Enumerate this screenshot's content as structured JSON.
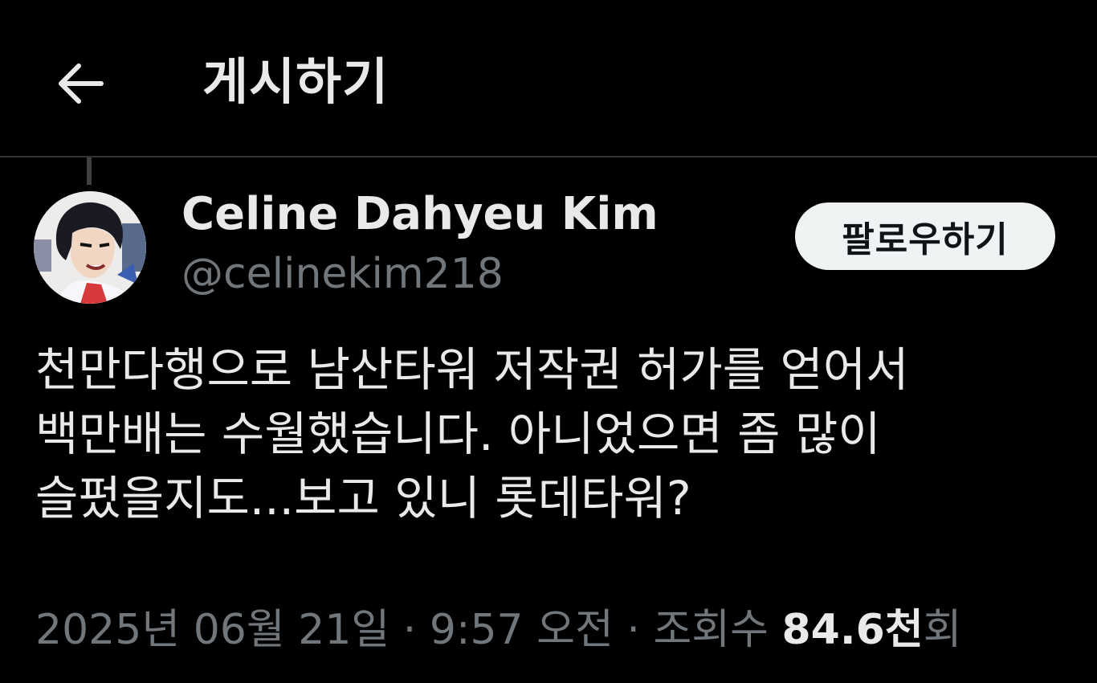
{
  "header": {
    "title": "게시하기",
    "back_icon": "arrow-left-icon"
  },
  "author": {
    "display_name": "Celine Dahyeu Kim",
    "handle": "@celinekim218",
    "follow_label": "팔로우하기"
  },
  "post": {
    "text": "천만다행으로 남산타워 저작권 허가를 얻어서\n백만배는 수월했습니다. 아니었으면 좀 많이\n슬펐을지도...보고 있니 롯데타워?"
  },
  "meta": {
    "date": "2025년 06월 21일",
    "separator": " · ",
    "time": "9:57 오전",
    "views_prefix": "조회수 ",
    "views_count": "84.6",
    "views_unit": "천",
    "views_suffix": "회"
  },
  "colors": {
    "background": "#000000",
    "text_primary": "#e7e9ea",
    "text_secondary": "#71767b",
    "divider": "#2f3336",
    "button_bg": "#eff3f4"
  }
}
